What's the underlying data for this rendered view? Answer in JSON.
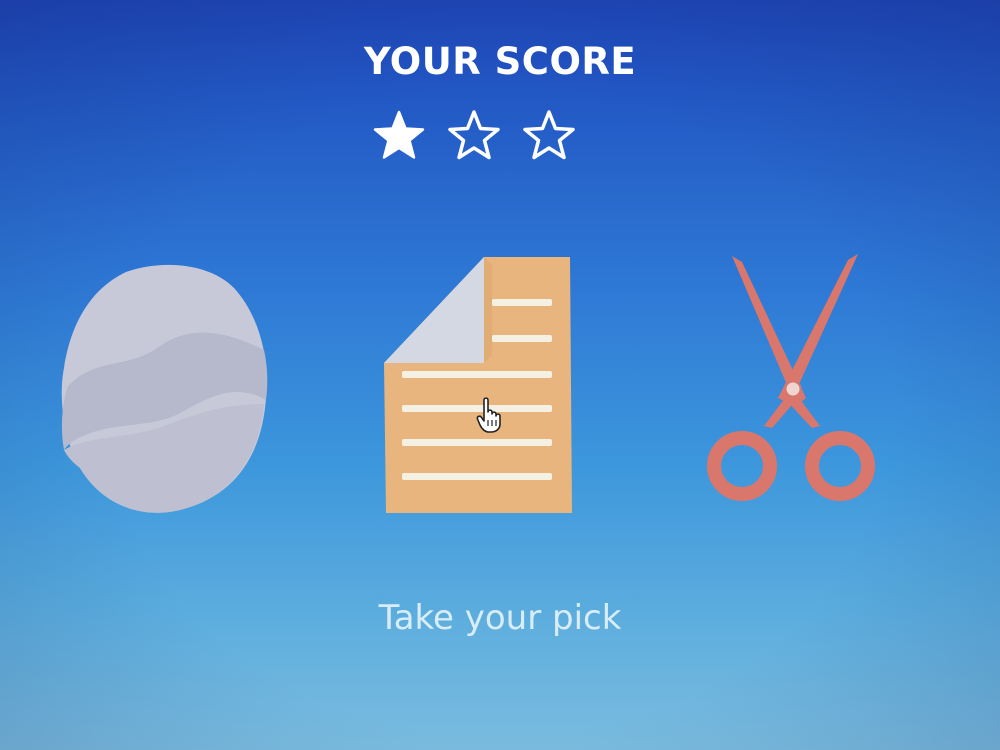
{
  "score": {
    "title": "YOUR SCORE",
    "stars_earned": 1,
    "stars_total": 3
  },
  "choices": [
    {
      "id": "rock",
      "icon": "rock-icon"
    },
    {
      "id": "paper",
      "icon": "paper-icon"
    },
    {
      "id": "scissors",
      "icon": "scissors-icon"
    }
  ],
  "prompt": "Take your pick",
  "colors": {
    "star": "#ffffff",
    "rock": "#c9cad8",
    "paper": "#e8b57e",
    "paper_fold": "#d4dae6",
    "paper_lines": "#f3f0e2",
    "scissors": "#d9776c",
    "prompt_text": "#d9edf7"
  }
}
